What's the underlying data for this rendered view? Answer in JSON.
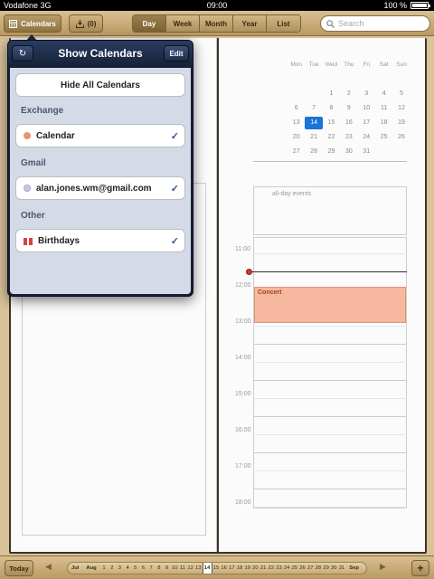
{
  "status": {
    "carrier": "Vodafone 3G",
    "time": "09:00",
    "battery": "100 %"
  },
  "toolbar": {
    "calendars_label": "Calendars",
    "inbox_label": "(0)",
    "views": [
      "Day",
      "Week",
      "Month",
      "Year",
      "List"
    ],
    "active_view": "Day",
    "search_placeholder": "Search"
  },
  "mini_month": {
    "weekdays": [
      "Mon",
      "Tue",
      "Wed",
      "Thu",
      "Fri",
      "Sat",
      "Sun"
    ],
    "weeks": [
      [
        "",
        "",
        "",
        "",
        "",
        "",
        ""
      ],
      [
        "",
        "",
        "1",
        "2",
        "3",
        "4",
        "5"
      ],
      [
        "6",
        "7",
        "8",
        "9",
        "10",
        "11",
        "12"
      ],
      [
        "13",
        "14",
        "15",
        "16",
        "17",
        "18",
        "19"
      ],
      [
        "20",
        "21",
        "22",
        "23",
        "24",
        "25",
        "26"
      ],
      [
        "27",
        "28",
        "29",
        "30",
        "31",
        "",
        ""
      ]
    ],
    "today": "14"
  },
  "day_view": {
    "allday_label": "all-day events",
    "hours": [
      "11:00",
      "12:00",
      "13:00",
      "14:00",
      "15:00",
      "16:00",
      "17:00",
      "18:00"
    ],
    "event": {
      "title": "Concert",
      "color": "#f6b89f"
    }
  },
  "popover": {
    "title": "Show Calendars",
    "edit_label": "Edit",
    "hide_all_label": "Hide All Calendars",
    "groups": [
      {
        "label": "Exchange",
        "calendar": "Calendar",
        "color": "#e8956e",
        "checked": true
      },
      {
        "label": "Gmail",
        "calendar": "alan.jones.wm@gmail.com",
        "color": "#c9c6ea",
        "checked": true
      },
      {
        "label": "Other",
        "calendar": "Birthdays",
        "icon": "gift-icon",
        "checked": true
      }
    ]
  },
  "bottom": {
    "today_label": "Today",
    "strip": [
      "Jul",
      "Aug",
      "1",
      "2",
      "3",
      "4",
      "5",
      "6",
      "7",
      "8",
      "9",
      "10",
      "11",
      "12",
      "13",
      "14",
      "15",
      "16",
      "17",
      "18",
      "19",
      "20",
      "21",
      "22",
      "23",
      "24",
      "25",
      "26",
      "27",
      "28",
      "29",
      "30",
      "31",
      "Sep"
    ],
    "selected_day": "14",
    "add_label": "+"
  },
  "colors": {
    "today": "#1a73d6",
    "now_line_dot": "#d33",
    "toolbar": "#c9ad78",
    "popover": "#152038"
  }
}
